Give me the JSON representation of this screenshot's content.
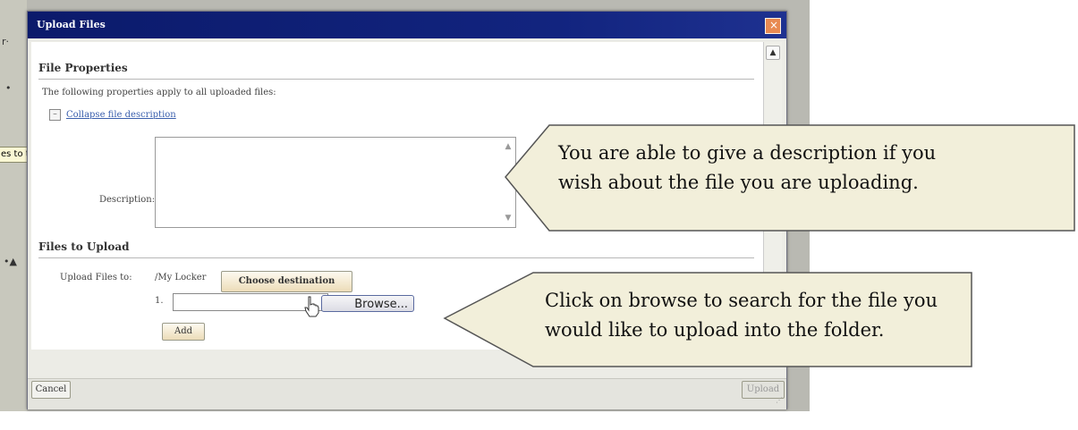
{
  "dialog": {
    "title": "Upload Files",
    "close_icon": "close-icon",
    "scroll_up_icon": "arrow-up-icon"
  },
  "file_properties": {
    "heading": "File Properties",
    "intro": "The following properties apply to all uploaded files:",
    "collapse_link": "Collapse file description",
    "description_label": "Description:",
    "description_value": ""
  },
  "files_to_upload": {
    "heading": "Files to Upload",
    "upload_to_label": "Upload Files to:",
    "upload_to_value": "/My Locker",
    "choose_destination_label": "Choose destination",
    "row_number": "1.",
    "file_path_value": "",
    "browse_label": "Browse...",
    "add_label": "Add"
  },
  "footer": {
    "cancel_label": "Cancel",
    "upload_label": "Upload"
  },
  "background": {
    "tooltip_text": "es to the locker"
  },
  "callouts": [
    {
      "lines": [
        "You are able to give a description if you",
        "wish about the file you are uploading."
      ]
    },
    {
      "lines": [
        "Click on browse to search for the file you",
        "would like to upload into the folder."
      ]
    }
  ],
  "colors": {
    "title_bar": "#0b1a6b",
    "callout_fill": "#f2efda",
    "link": "#3a5fad",
    "button_gold": "#ecdcb8"
  }
}
